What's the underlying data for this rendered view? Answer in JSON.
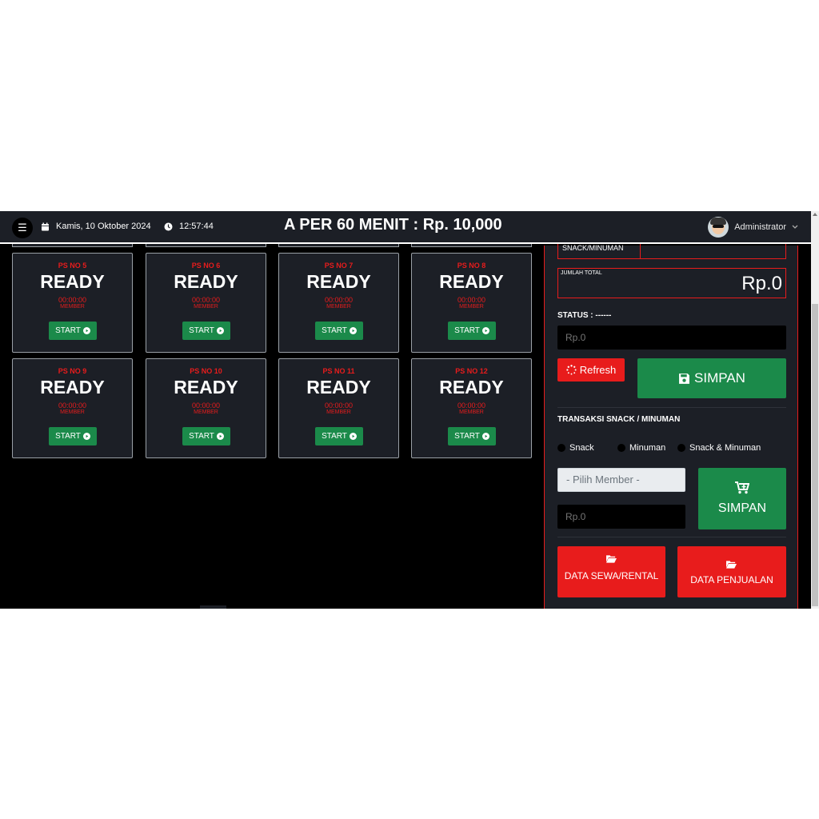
{
  "topbar": {
    "date": "Kamis, 10 Oktober 2024",
    "time": "12:57:44",
    "marquee": "A PER 60 MENIT : Rp. 10,000",
    "user_name": "Administrator"
  },
  "consoles": [
    {
      "title": "PS NO 5",
      "status": "READY",
      "timer": "00:00:00",
      "member": "MEMBER",
      "start_label": "START"
    },
    {
      "title": "PS NO 6",
      "status": "READY",
      "timer": "00:00:00",
      "member": "MEMBER",
      "start_label": "START"
    },
    {
      "title": "PS NO 7",
      "status": "READY",
      "timer": "00:00:00",
      "member": "MEMBER",
      "start_label": "START"
    },
    {
      "title": "PS NO 8",
      "status": "READY",
      "timer": "00:00:00",
      "member": "MEMBER",
      "start_label": "START"
    },
    {
      "title": "PS NO 9",
      "status": "READY",
      "timer": "00:00:00",
      "member": "MEMBER",
      "start_label": "START"
    },
    {
      "title": "PS NO 10",
      "status": "READY",
      "timer": "00:00:00",
      "member": "MEMBER",
      "start_label": "START"
    },
    {
      "title": "PS NO 11",
      "status": "READY",
      "timer": "00:00:00",
      "member": "MEMBER",
      "start_label": "START"
    },
    {
      "title": "PS NO 12",
      "status": "READY",
      "timer": "00:00:00",
      "member": "MEMBER",
      "start_label": "START"
    }
  ],
  "panel": {
    "snack_label": "SNACK/MINUMAN",
    "total_label": "JUMLAH TOTAL",
    "total_value": "Rp.0",
    "status_text": "STATUS : ------",
    "amount_placeholder": "Rp.0",
    "refresh_label": "Refresh",
    "simpan_label": "SIMPAN",
    "trx_title": "TRANSAKSI SNACK / MINUMAN",
    "radio_options": [
      "Snack",
      "Minuman",
      "Snack & Minuman"
    ],
    "member_select": "- Pilih Member -",
    "snack_amount_placeholder": "Rp.0",
    "simpan_snack_label": "SIMPAN",
    "data_sewa_label": "DATA SEWA/RENTAL",
    "data_penjualan_label": "DATA PENJUALAN"
  },
  "colors": {
    "accent_red": "#e81c1c",
    "accent_green": "#1b8a4a",
    "card_bg": "#1c1f26"
  },
  "icons": [
    "menu-icon",
    "calendar-icon",
    "clock-icon",
    "play-circle-icon",
    "spinner-icon",
    "save-icon",
    "cart-plus-icon",
    "folder-open-icon",
    "chevron-down-icon"
  ]
}
